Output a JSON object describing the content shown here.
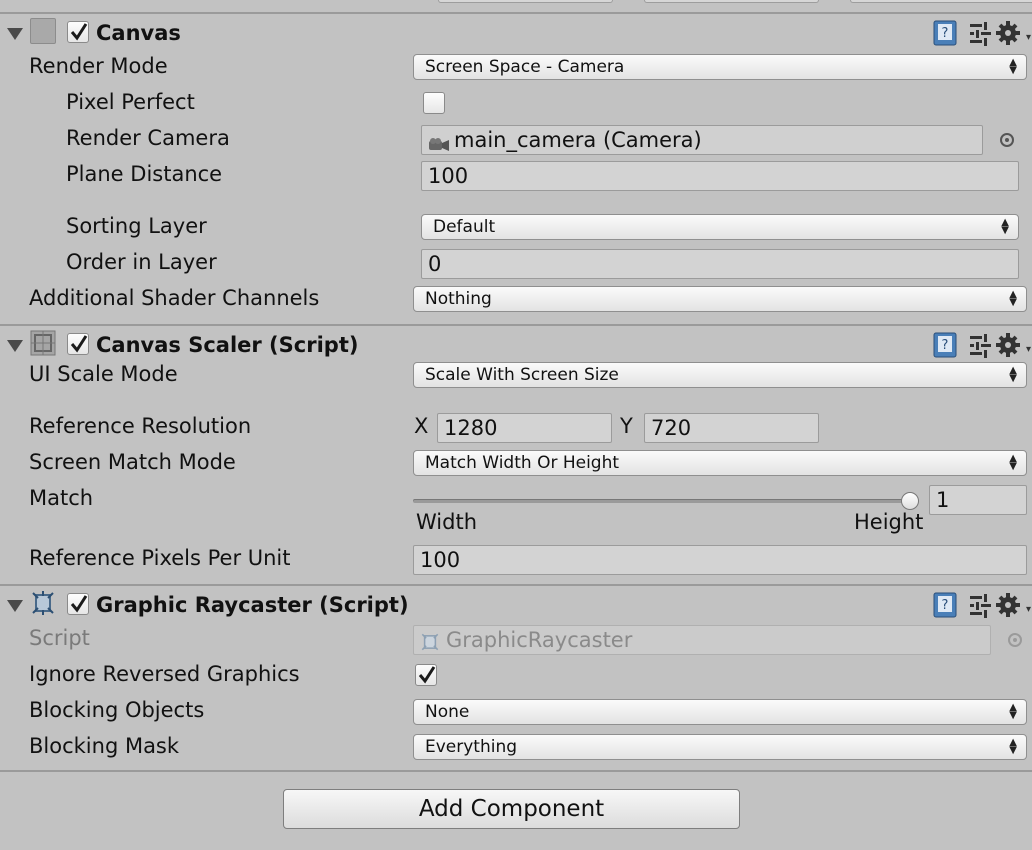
{
  "canvas": {
    "title": "Canvas",
    "enabled": true,
    "render_mode": {
      "label": "Render Mode",
      "value": "Screen Space - Camera"
    },
    "pixel_perfect": {
      "label": "Pixel Perfect",
      "checked": false
    },
    "render_camera": {
      "label": "Render Camera",
      "value": "main_camera (Camera)"
    },
    "plane_distance": {
      "label": "Plane Distance",
      "value": "100"
    },
    "sorting_layer": {
      "label": "Sorting Layer",
      "value": "Default"
    },
    "order_in_layer": {
      "label": "Order in Layer",
      "value": "0"
    },
    "shader_channels": {
      "label": "Additional Shader Channels",
      "value": "Nothing"
    }
  },
  "canvas_scaler": {
    "title": "Canvas Scaler (Script)",
    "enabled": true,
    "ui_scale_mode": {
      "label": "UI Scale Mode",
      "value": "Scale With Screen Size"
    },
    "reference_resolution": {
      "label": "Reference Resolution",
      "x_label": "X",
      "x": "1280",
      "y_label": "Y",
      "y": "720"
    },
    "screen_match_mode": {
      "label": "Screen Match Mode",
      "value": "Match Width Or Height"
    },
    "match": {
      "label": "Match",
      "value": "1",
      "slider_fraction": 1,
      "min_label": "Width",
      "max_label": "Height"
    },
    "ref_pixels_per_unit": {
      "label": "Reference Pixels Per Unit",
      "value": "100"
    }
  },
  "graphic_raycaster": {
    "title": "Graphic Raycaster (Script)",
    "enabled": true,
    "script": {
      "label": "Script",
      "value": "GraphicRaycaster"
    },
    "ignore_reversed": {
      "label": "Ignore Reversed Graphics",
      "checked": true
    },
    "blocking_objects": {
      "label": "Blocking Objects",
      "value": "None"
    },
    "blocking_mask": {
      "label": "Blocking Mask",
      "value": "Everything"
    }
  },
  "add_component": {
    "label": "Add Component"
  },
  "icons": {
    "foldout": "foldout-arrow-icon",
    "help": "help-book-icon",
    "preset": "preset-sliders-icon",
    "settings": "gear-icon",
    "object_picker": "object-picker-icon",
    "camera": "camera-icon",
    "script": "script-icon"
  }
}
